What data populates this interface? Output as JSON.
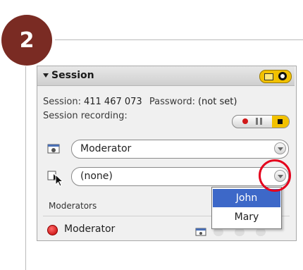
{
  "step": {
    "number": "2"
  },
  "panel": {
    "title": "Session",
    "session_label": "Session:",
    "session_id": "411 467 073",
    "password_label": "Password:",
    "password_value": "(not set)",
    "recording_label": "Session recording:",
    "role_select": {
      "value": "Moderator"
    },
    "presenter_select": {
      "value": "(none)"
    },
    "section_label": "Moderators",
    "list": [
      {
        "name": "Moderator",
        "status": "red-dot-icon"
      }
    ]
  },
  "dropdown": {
    "options": [
      {
        "label": "John",
        "selected": true
      },
      {
        "label": "Mary",
        "selected": false
      }
    ]
  },
  "colors": {
    "badge": "#7a2b23",
    "accent_yellow": "#f2c100",
    "highlight_ring": "#e4001c",
    "selected_item": "#3d68c8",
    "record_red": "#d01818"
  },
  "icons": [
    "collapse-arrow-icon",
    "camera-icon",
    "pointer-icon",
    "record-icon",
    "pause-icon",
    "stop-icon",
    "chevron-down-icon"
  ]
}
